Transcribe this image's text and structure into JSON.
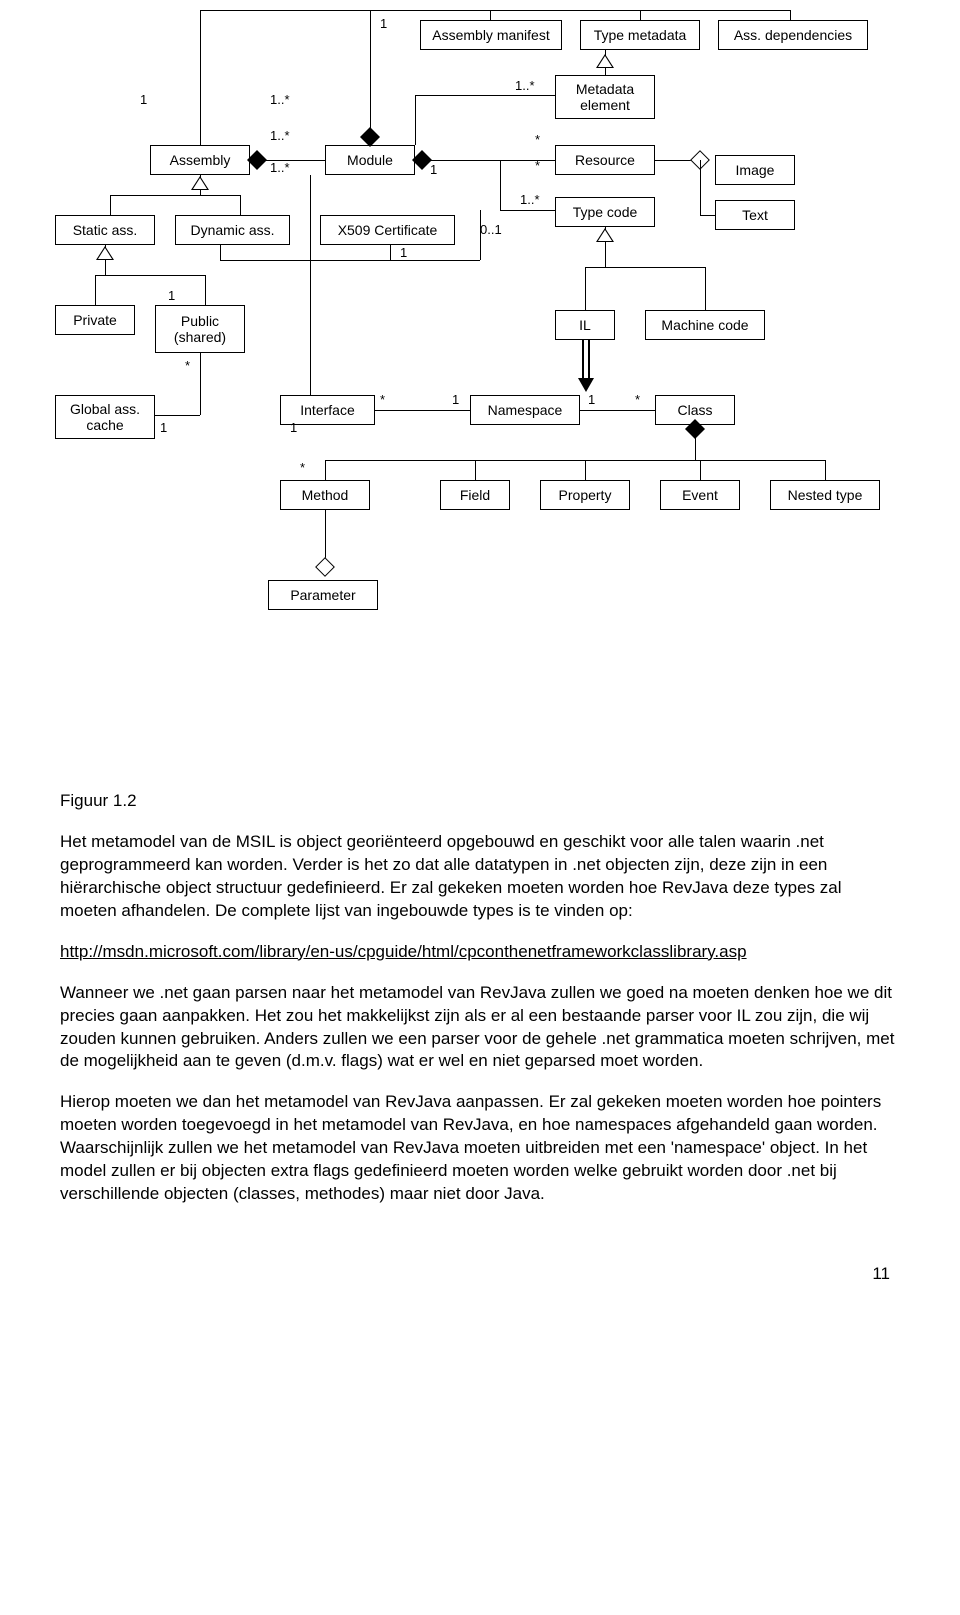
{
  "diagram": {
    "entities": {
      "assembly_manifest": "Assembly manifest",
      "type_metadata": "Type metadata",
      "ass_dependencies": "Ass. dependencies",
      "metadata_element": "Metadata\nelement",
      "assembly": "Assembly",
      "module": "Module",
      "resource": "Resource",
      "image": "Image",
      "static_ass": "Static ass.",
      "dynamic_ass": "Dynamic ass.",
      "x509": "X509 Certificate",
      "type_code": "Type code",
      "text": "Text",
      "private": "Private",
      "public_shared": "Public\n(shared)",
      "il": "IL",
      "machine_code": "Machine code",
      "global_ass_cache": "Global ass.\ncache",
      "interface": "Interface",
      "namespace": "Namespace",
      "class": "Class",
      "method": "Method",
      "field": "Field",
      "property": "Property",
      "event": "Event",
      "nested_type": "Nested type",
      "parameter": "Parameter"
    },
    "multiplicities": {
      "one": "1",
      "one_star": "1..*",
      "star": "*",
      "zero_one": "0..1"
    },
    "caption": "Figuur 1.2"
  },
  "text": {
    "p1a": "Het metamodel van de MSIL is object georiënteerd opgebouwd en geschikt voor alle talen waarin .net geprogrammeerd kan worden. Verder is het zo dat alle datatypen in .net objecten zijn, deze zijn in een hiërarchische object structuur gedefinieerd. Er zal gekeken moeten worden hoe RevJava deze types zal moeten afhandelen. De complete lijst van ingebouwde types is te vinden op:",
    "link": "http://msdn.microsoft.com/library/en-us/cpguide/html/cpconthenetframeworkclasslibrary.asp",
    "p2": "Wanneer we .net gaan parsen naar het metamodel van RevJava zullen we goed na moeten denken hoe we dit precies gaan aanpakken. Het zou het makkelijkst zijn als er al een bestaande parser voor IL zou zijn, die wij zouden kunnen gebruiken. Anders zullen we een parser voor de gehele .net grammatica moeten schrijven, met de mogelijkheid aan te geven (d.m.v. flags) wat er wel en niet geparsed moet worden.",
    "p3": "Hierop moeten we dan het metamodel van RevJava aanpassen. Er zal gekeken moeten worden hoe pointers moeten worden toegevoegd in het metamodel van RevJava, en hoe namespaces afgehandeld gaan worden. Waarschijnlijk zullen we het metamodel van RevJava moeten uitbreiden met een 'namespace' object. In het model zullen er bij objecten extra flags gedefinieerd moeten worden welke gebruikt worden door .net bij verschillende objecten (classes, methodes) maar niet door Java."
  },
  "page_number": "11"
}
